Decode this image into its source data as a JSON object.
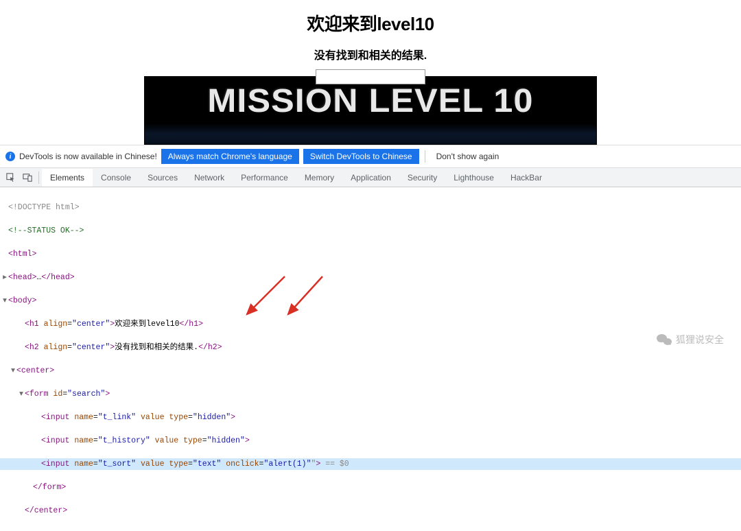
{
  "page": {
    "title": "欢迎来到level10",
    "subtitle": "没有找到和相关的结果.",
    "banner_text": "MISSION LEVEL 10"
  },
  "devtools": {
    "notice": {
      "info_text": "DevTools is now available in Chinese!",
      "btn_match": "Always match Chrome's language",
      "btn_switch": "Switch DevTools to Chinese",
      "btn_dismiss": "Don't show again"
    },
    "tabs": [
      "Elements",
      "Console",
      "Sources",
      "Network",
      "Performance",
      "Memory",
      "Application",
      "Security",
      "Lighthouse",
      "HackBar"
    ],
    "active_tab": "Elements",
    "dom": {
      "doctype": "<!DOCTYPE html>",
      "comment": "<!--STATUS OK-->",
      "html_open": "<html>",
      "head_line": "<head>…</head>",
      "body_open": "<body>",
      "h1_align": "center",
      "h1_text": "欢迎来到level10",
      "h2_align": "center",
      "h2_text": "没有找到和相关的结果.",
      "center_open": "<center>",
      "form_id": "search",
      "input1": {
        "name": "t_link",
        "type": "hidden"
      },
      "input2": {
        "name": "t_history",
        "type": "hidden"
      },
      "input3": {
        "name": "t_sort",
        "type": "text",
        "onclick": "alert(1)"
      },
      "selected_hint": " == $0",
      "form_close": "</form>",
      "center_close": "</center>"
    }
  },
  "watermark": {
    "text": "狐狸说安全"
  }
}
